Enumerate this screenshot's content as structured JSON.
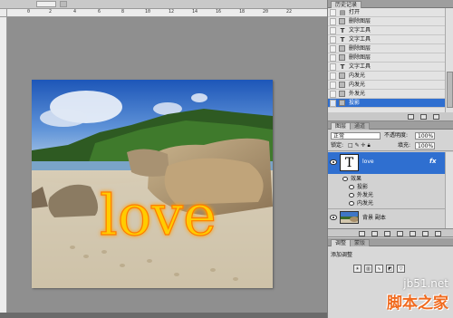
{
  "ruler": {
    "marks": [
      "0",
      "2",
      "4",
      "6",
      "8",
      "10",
      "12",
      "14",
      "16",
      "18",
      "20",
      "22"
    ]
  },
  "canvas": {
    "text_layer_content": "love",
    "text_color": "#ffcc00",
    "glow_color": "#ff7a00"
  },
  "history": {
    "tab": "历史记录",
    "items": [
      {
        "label": "打开",
        "icon": "document-icon"
      },
      {
        "label": "删除图层",
        "icon": "layer-icon"
      },
      {
        "label": "文字工具",
        "icon": "text-tool-icon"
      },
      {
        "label": "文字工具",
        "icon": "text-tool-icon"
      },
      {
        "label": "删除图层",
        "icon": "layer-icon"
      },
      {
        "label": "删除图层",
        "icon": "layer-icon"
      },
      {
        "label": "文字工具",
        "icon": "text-tool-icon"
      },
      {
        "label": "内发光",
        "icon": "layer-icon"
      },
      {
        "label": "内发光",
        "icon": "layer-icon"
      },
      {
        "label": "外发光",
        "icon": "layer-icon"
      },
      {
        "label": "投影",
        "icon": "layer-icon",
        "selected": true
      }
    ]
  },
  "layers": {
    "tabs": [
      "图层",
      "通道"
    ],
    "blend_mode": "正常",
    "opacity_label": "不透明度:",
    "opacity_value": "100%",
    "lock_label": "锁定:",
    "fill_label": "填充:",
    "fill_value": "100%",
    "text_layer": {
      "name": "love",
      "thumb_letter": "T",
      "fx": "fx"
    },
    "effects_label": "效果",
    "effects": [
      "投影",
      "外发光",
      "内发光"
    ],
    "bg_layer": {
      "name": "背景 副本"
    }
  },
  "adjustments": {
    "tabs": [
      "调整",
      "蒙版"
    ],
    "title": "添加调整"
  },
  "watermark": {
    "url": "jb51.net",
    "name": "脚本之家"
  },
  "colors": {
    "selection": "#2f6fd0",
    "panel_bg": "#cfcfcf",
    "workspace": "#8f8f8f"
  }
}
